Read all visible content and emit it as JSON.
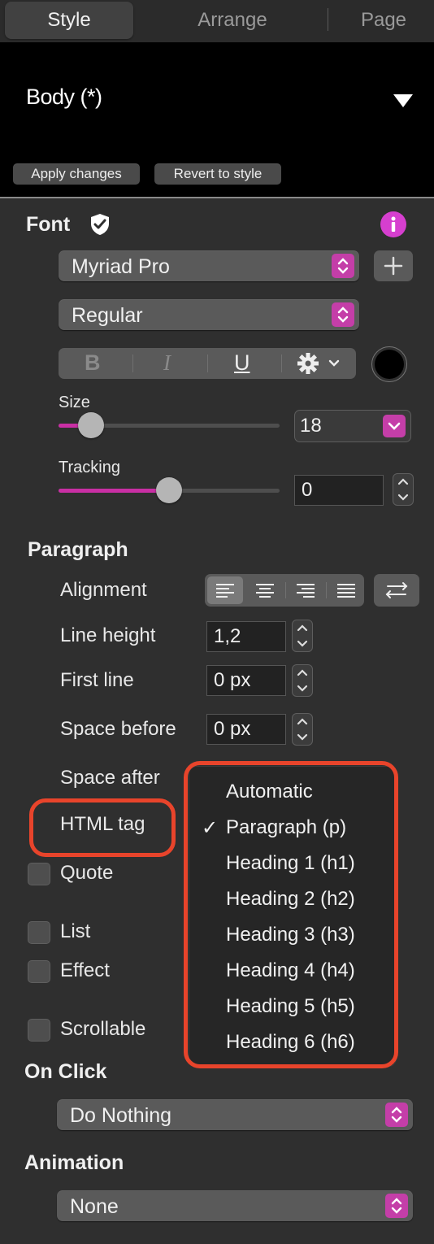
{
  "tabs": [
    {
      "label": "Style",
      "active": true
    },
    {
      "label": "Arrange",
      "active": false
    },
    {
      "label": "Page",
      "active": false
    }
  ],
  "style_header": {
    "name": "Body (*)",
    "apply_label": "Apply changes",
    "revert_label": "Revert to style"
  },
  "font": {
    "section_label": "Font",
    "family": "Myriad Pro",
    "weight": "Regular",
    "bold_glyph": "B",
    "italic_glyph": "I",
    "underline_glyph": "U",
    "color": "#000000",
    "size_label": "Size",
    "size_value": "18",
    "size_fraction": 0.1,
    "tracking_label": "Tracking",
    "tracking_value": "0",
    "tracking_fraction": 0.5
  },
  "paragraph": {
    "section_label": "Paragraph",
    "alignment_label": "Alignment",
    "line_height_label": "Line height",
    "line_height_value": "1,2",
    "first_line_label": "First line",
    "first_line_value": "0 px",
    "space_before_label": "Space before",
    "space_before_value": "0 px",
    "space_after_label": "Space after",
    "html_tag_label": "HTML tag"
  },
  "checkboxes": {
    "quote": "Quote",
    "list": "List",
    "effect": "Effect",
    "scrollable": "Scrollable"
  },
  "html_tag_menu": {
    "items": [
      "Automatic",
      "Paragraph (p)",
      "Heading 1 (h1)",
      "Heading 2 (h2)",
      "Heading 3 (h3)",
      "Heading 4 (h4)",
      "Heading 5 (h5)",
      "Heading 6 (h6)"
    ],
    "checked": "Paragraph (p)",
    "check_glyph": "✓"
  },
  "on_click": {
    "label": "On Click",
    "value": "Do Nothing"
  },
  "animation": {
    "label": "Animation",
    "value": "None"
  },
  "colors": {
    "accent": "#c43ea8",
    "highlight": "#e8442b",
    "info": "#d63fcf"
  }
}
